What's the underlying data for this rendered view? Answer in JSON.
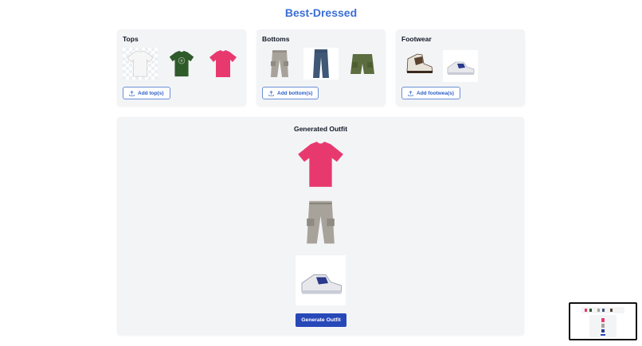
{
  "app": {
    "title": "Best-Dressed"
  },
  "categories": [
    {
      "title": "Tops",
      "button_label": "Add top(s)",
      "items": [
        "white-tshirt-icon",
        "green-graphic-tshirt-icon",
        "pink-tshirt-icon"
      ]
    },
    {
      "title": "Bottoms",
      "button_label": "Add bottom(s)",
      "items": [
        "grey-cargo-pants-icon",
        "blue-jeans-icon",
        "olive-cargo-shorts-icon"
      ]
    },
    {
      "title": "Footwear",
      "button_label": "Add footwea(s)",
      "items": [
        "brown-high-top-sneaker-icon",
        "white-navy-sneaker-icon"
      ]
    }
  ],
  "outfit": {
    "title": "Generated Outfit",
    "items": [
      "pink-tshirt-icon",
      "grey-cargo-pants-icon",
      "white-navy-sneaker-icon"
    ],
    "generate_label": "Generate Outfit"
  },
  "colors": {
    "accent": "#2748b8",
    "title": "#3b6fd4",
    "card_bg": "#f3f4f6",
    "pink_tee": "#e8396f",
    "green_tee": "#2f5a2a",
    "white_tee": "#f4f4f4"
  }
}
